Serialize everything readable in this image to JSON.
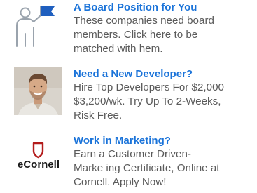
{
  "ads": [
    {
      "title": "A Board Position for You",
      "body": "These companies need board\nmembers. Click here to be\nmatched with  hem.",
      "icon": "board-presenter-flag-icon"
    },
    {
      "title": "Need a New Developer?",
      "body": "Hire Top Developers For $2,000\n$3,200/wk. Try Up To 2-Weeks,\nRisk Free.",
      "icon": "developer-portrait-photo"
    },
    {
      "title": "Work in Marketing?",
      "body": "Earn a Customer Driven-\nMarke ing Certificate, Online at\nCornell. Apply Now!",
      "icon": "ecornell-logo",
      "logo_text": "eCornell"
    }
  ],
  "colors": {
    "title": "#1a73d9",
    "body": "#5a5a5a",
    "icon_blue": "#1f5fbf",
    "ecornell_red": "#b31b1b"
  }
}
